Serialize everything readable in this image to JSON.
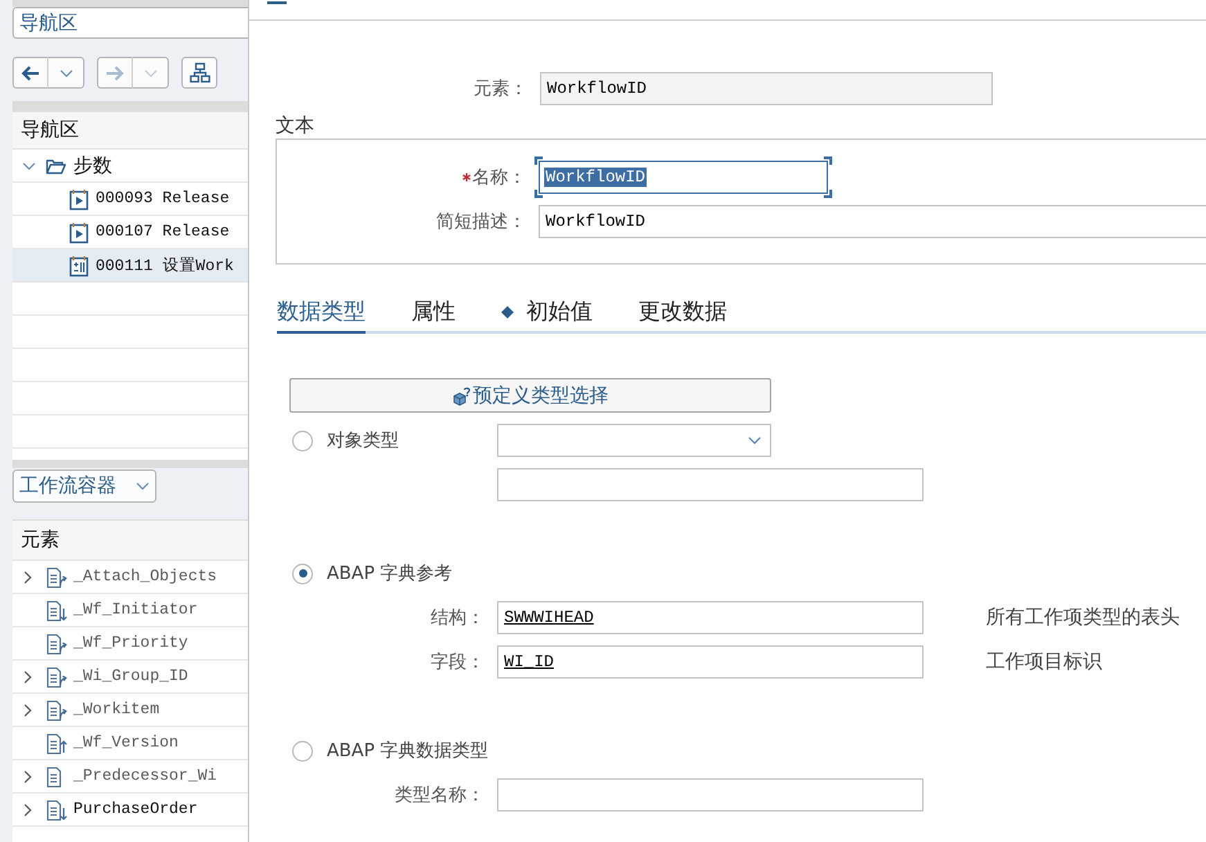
{
  "nav_panel": {
    "selector": "导航区",
    "toolbar": [
      {
        "kind": "back",
        "disabled": false
      },
      {
        "kind": "forward",
        "disabled": true
      },
      {
        "kind": "overview",
        "disabled": false
      }
    ],
    "tree": {
      "header": "导航区",
      "nodes": [
        {
          "label": "步数",
          "kind": "folder",
          "expanded": true,
          "selected": false,
          "children": [
            {
              "label": "000093 Release",
              "kind": "activity",
              "selected": false
            },
            {
              "label": "000107 Release",
              "kind": "activity",
              "selected": false
            },
            {
              "label": "000111 设置Work",
              "kind": "container_operation",
              "selected": true
            }
          ]
        }
      ]
    }
  },
  "container_panel": {
    "selector": "工作流容器",
    "header": "元素",
    "elements": [
      {
        "name": "_Attach_Objects",
        "expandable": true,
        "system": true,
        "kind": "import_export"
      },
      {
        "name": "_Wf_Initiator",
        "expandable": false,
        "system": true,
        "kind": "import"
      },
      {
        "name": "_Wf_Priority",
        "expandable": false,
        "system": true,
        "kind": "import_export"
      },
      {
        "name": "_Wi_Group_ID",
        "expandable": true,
        "system": true,
        "kind": "import_export"
      },
      {
        "name": "_Workitem",
        "expandable": true,
        "system": true,
        "kind": "import_export"
      },
      {
        "name": "_Wf_Version",
        "expandable": false,
        "system": true,
        "kind": "export"
      },
      {
        "name": "_Predecessor_Wi",
        "expandable": true,
        "system": true,
        "kind": "local"
      },
      {
        "name": "PurchaseOrder",
        "expandable": true,
        "system": false,
        "kind": "import"
      }
    ]
  },
  "dialog": {
    "element": {
      "label": "元素：",
      "value": "WorkflowID"
    },
    "text_group": {
      "title": "文本",
      "fields": [
        {
          "label": "名称：",
          "value": "WorkflowID",
          "required": true,
          "focused": true
        },
        {
          "label": "简短描述：",
          "value": "WorkflowID",
          "required": false,
          "focused": false
        }
      ]
    },
    "tabs": [
      {
        "label": "数据类型",
        "selected": true,
        "indicator": false
      },
      {
        "label": "属性",
        "selected": false,
        "indicator": false
      },
      {
        "label": "初始值",
        "selected": false,
        "indicator": true
      },
      {
        "label": "更改数据",
        "selected": false,
        "indicator": false
      }
    ],
    "predefined_type_button": "预定义类型选择",
    "type_options": [
      {
        "kind": "object_type",
        "label": "对象类型",
        "selected": false,
        "fields": [
          {
            "kind": "dropdown"
          },
          {
            "kind": "input"
          }
        ]
      },
      {
        "kind": "dictionary_reference",
        "label": "ABAP 字典参考",
        "selected": true,
        "fields": [
          {
            "kind": "input",
            "label": "结构：",
            "value": "SWWWIHEAD",
            "linked": true,
            "description": "所有工作项类型的表头"
          },
          {
            "kind": "input",
            "label": "字段：",
            "value": "WI_ID",
            "linked": true,
            "description": "工作项目标识"
          }
        ]
      },
      {
        "kind": "dictionary_type",
        "label": "ABAP 字典数据类型",
        "selected": false,
        "fields": [
          {
            "kind": "input",
            "label": "类型名称："
          }
        ]
      }
    ]
  }
}
